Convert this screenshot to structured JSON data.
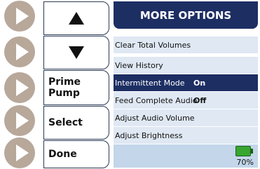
{
  "colors": {
    "header_bg": "#1d2e63",
    "row_bg": "#dfe8f3",
    "selected_bg": "#1d2e63",
    "footer_bg": "#c3d6ea",
    "hw_button": "#b8a89a",
    "battery": "#38a630"
  },
  "hw_buttons": {
    "icon": "play-triangle-icon"
  },
  "softkeys": {
    "up_icon": "arrow-up-icon",
    "down_icon": "arrow-down-icon",
    "prime_line1": "Prime",
    "prime_line2": "Pump",
    "select": "Select",
    "done": "Done"
  },
  "panel": {
    "title": "MORE OPTIONS",
    "rows": [
      {
        "label": "Clear Total Volumes",
        "value": ""
      },
      {
        "label": "View History",
        "value": ""
      },
      {
        "label": "Intermittent Mode",
        "value": "On",
        "selected": true
      },
      {
        "label": "Feed Complete Audio",
        "value": "Off"
      },
      {
        "label": "Adjust Audio Volume",
        "value": ""
      },
      {
        "label": "Adjust Brightness",
        "value": ""
      }
    ]
  },
  "battery": {
    "percent_label": "70%",
    "level": 0.7
  }
}
